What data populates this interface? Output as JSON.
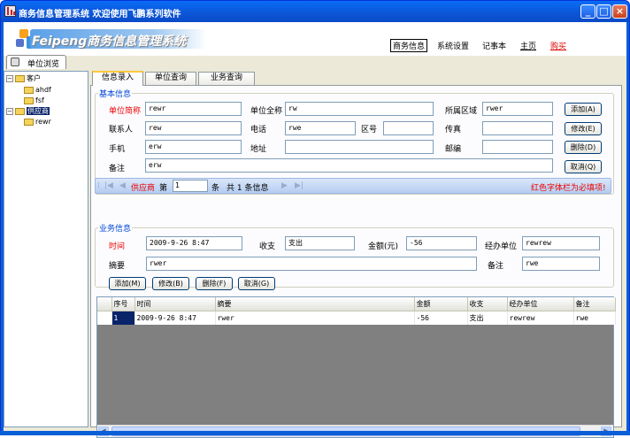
{
  "window": {
    "title": "商务信息管理系统 欢迎使用飞鹏系列软件"
  },
  "brand": {
    "logo_text": "Feipeng商务信息管理系统"
  },
  "top_nav": [
    {
      "label": "商务信息",
      "selected": true
    },
    {
      "label": "系统设置"
    },
    {
      "label": "记事本"
    },
    {
      "label": "主页"
    },
    {
      "label": "购买"
    }
  ],
  "main_tab": {
    "label": "单位浏览"
  },
  "tree": [
    {
      "label": "客户",
      "expanded": true,
      "children": [
        "ahdf",
        "fsf"
      ]
    },
    {
      "label": "供应商",
      "expanded": true,
      "selected": true,
      "children": [
        "rewr"
      ]
    }
  ],
  "tabs": [
    "信息录入",
    "单位查询",
    "业务查询"
  ],
  "basic": {
    "section_title": "基本信息",
    "labels": {
      "short_name": "单位简称",
      "full_name": "单位全称",
      "region": "所属区域",
      "contact": "联系人",
      "phone": "电话",
      "area_code": "区号",
      "fax": "传真",
      "mobile": "手机",
      "address": "地址",
      "postcode": "邮编",
      "remark": "备注"
    },
    "values": {
      "short_name": "rewr",
      "full_name": "rw",
      "region": "rwer",
      "contact": "rew",
      "phone": "rwe",
      "area_code": "",
      "fax": "",
      "mobile": "erw",
      "address": "",
      "postcode": "",
      "remark": "erw"
    },
    "buttons": {
      "add": "添加(A)",
      "edit": "修改(E)",
      "delete": "删除(D)",
      "cancel": "取消(Q)"
    }
  },
  "navigator": {
    "category": "供应商",
    "page_prefix": "第",
    "page_value": "1",
    "record_suffix": "条",
    "total_text": "共 1 条信息",
    "required_hint": "红色字体栏为必填项!"
  },
  "business": {
    "section_title": "业务信息",
    "labels": {
      "time": "时间",
      "type": "收支",
      "amount": "金额(元)",
      "handler": "经办单位",
      "summary": "摘要",
      "remark": "备注"
    },
    "values": {
      "time": "2009-9-26 8:47",
      "type": "支出",
      "amount": "-56",
      "handler": "rewrew",
      "summary": "rwer",
      "remark": "rwe"
    },
    "buttons": {
      "add": "添加(M)",
      "edit": "修改(B)",
      "delete": "删除(F)",
      "cancel": "取消(G)"
    }
  },
  "grid": {
    "columns": [
      "序号",
      "时间",
      "摘要",
      "金额",
      "收支",
      "经办单位",
      "备注"
    ],
    "rows": [
      [
        "1",
        "2009-9-26 8:47",
        "rwer",
        "-56",
        "支出",
        "rewrew",
        "rwe"
      ]
    ]
  },
  "colors": {
    "titlebar": "#0b55d6",
    "required_label": "#e00000",
    "section_title": "#0046d5",
    "grid_empty": "#808080"
  }
}
